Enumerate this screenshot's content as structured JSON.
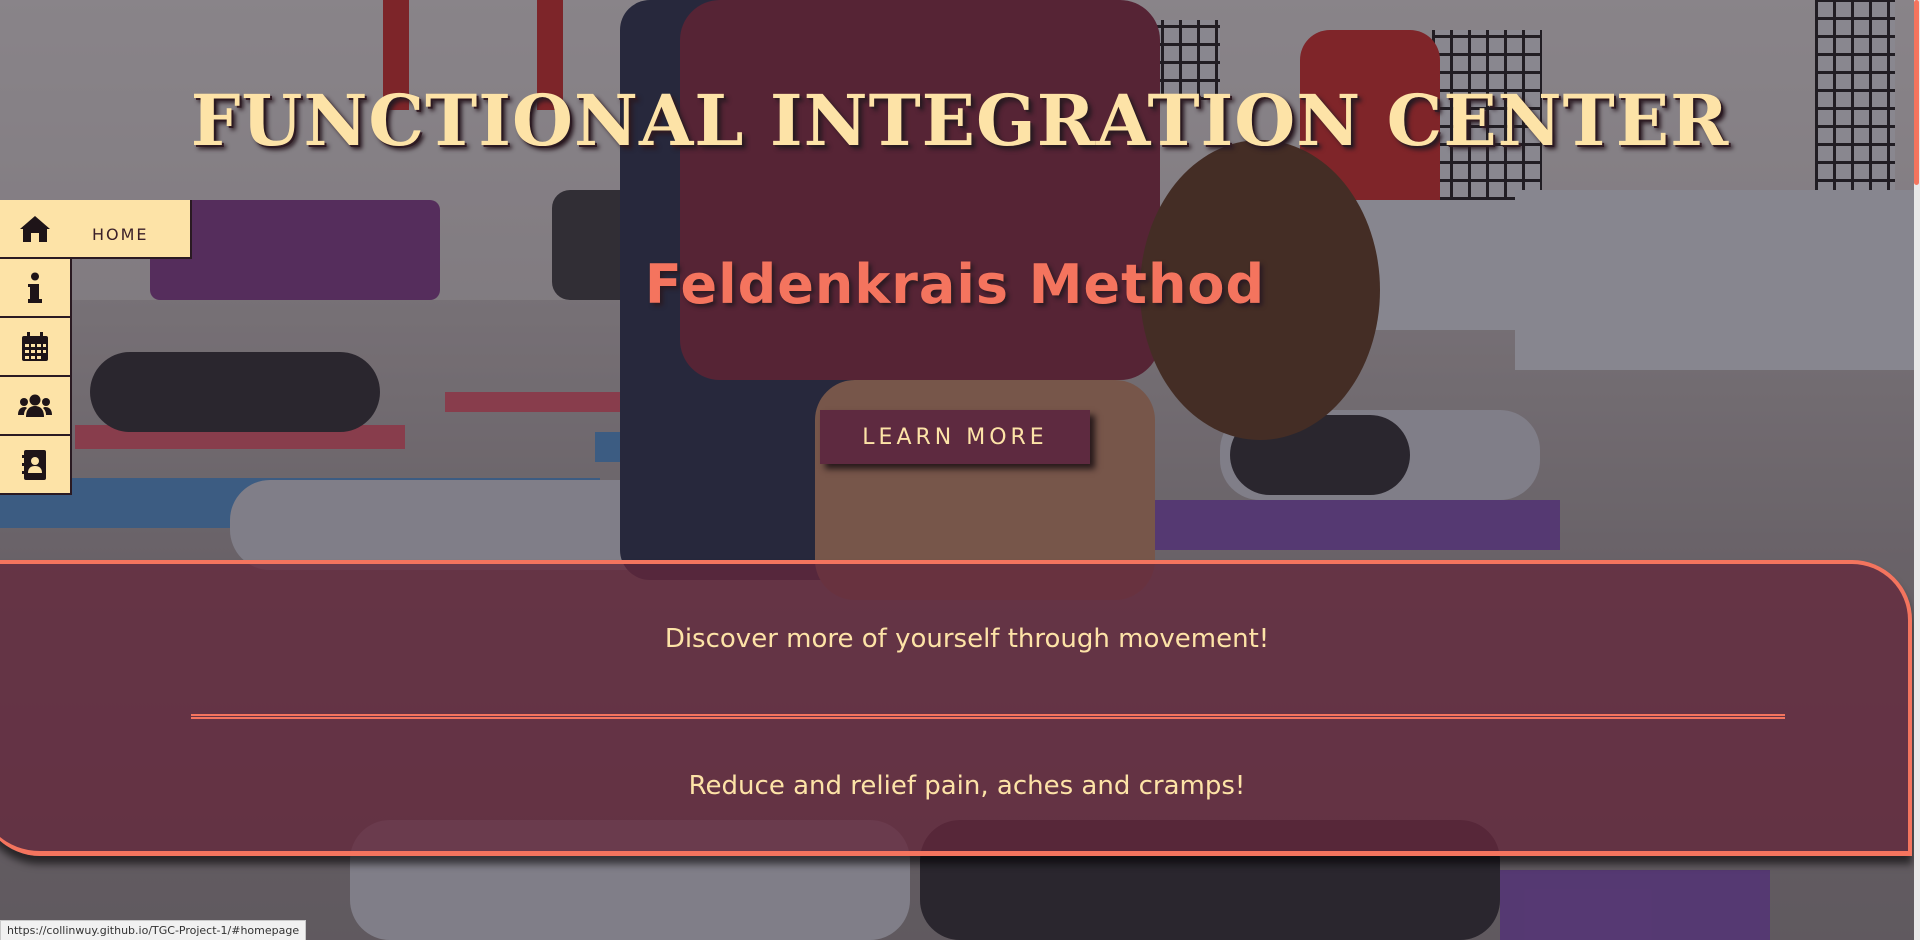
{
  "header": {
    "title": "FUNCTIONAL INTEGRATION CENTER",
    "subtitle": "Feldenkrais Method",
    "cta_label": "LEARN MORE"
  },
  "sidenav": {
    "items": [
      {
        "icon": "home-icon",
        "label": "HOME",
        "active": true
      },
      {
        "icon": "info-icon",
        "label": ""
      },
      {
        "icon": "calendar-icon",
        "label": ""
      },
      {
        "icon": "users-icon",
        "label": ""
      },
      {
        "icon": "contact-book-icon",
        "label": ""
      }
    ]
  },
  "info_panel": {
    "line1": "Discover more of yourself through movement!",
    "line2": "Reduce and relief pain, aches and cramps!"
  },
  "status_bar": {
    "url": "https://collinwuy.github.io/TGC-Project-1/#homepage"
  },
  "colors": {
    "cream": "#fde3a7",
    "coral": "#f4745e",
    "plum": "#5e2a40",
    "dark": "#2a1a22"
  }
}
